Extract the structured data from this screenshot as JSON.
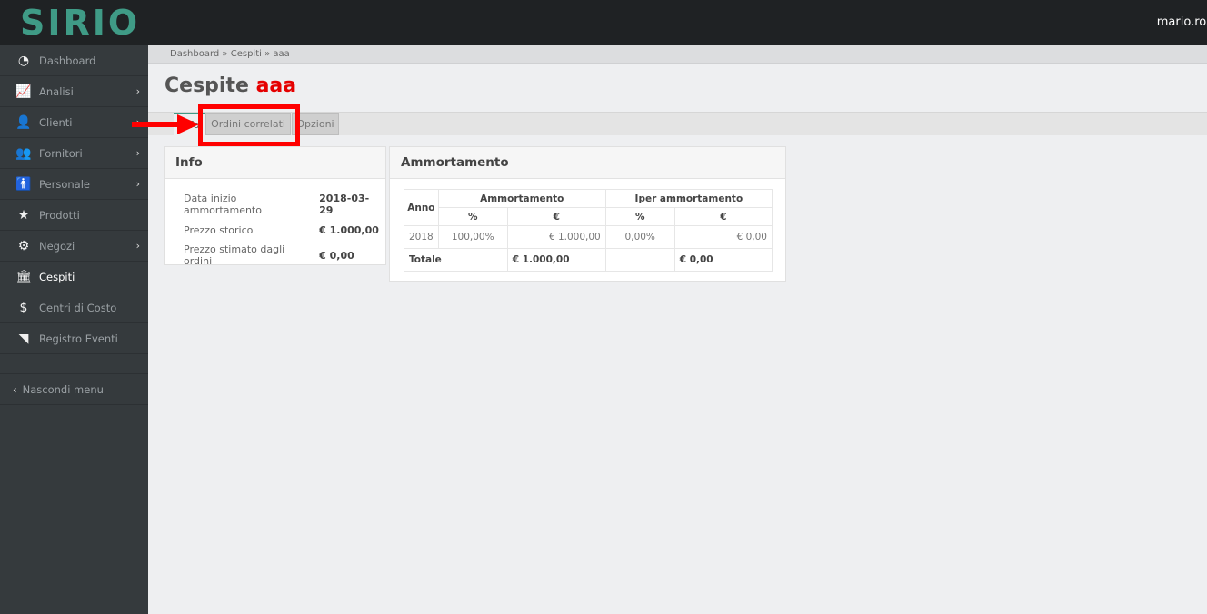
{
  "app": {
    "logo": "SIRIO",
    "user": "mario.ros"
  },
  "sidebar": {
    "items": [
      {
        "label": "Dashboard",
        "icon": "dashboard-icon",
        "glyph": "◔",
        "chevron": false,
        "active": false
      },
      {
        "label": "Analisi",
        "icon": "line-chart-icon",
        "glyph": "📈",
        "chevron": true,
        "active": false
      },
      {
        "label": "Clienti",
        "icon": "user-icon",
        "glyph": "👤",
        "chevron": true,
        "active": false
      },
      {
        "label": "Fornitori",
        "icon": "users-icon",
        "glyph": "👥",
        "chevron": true,
        "active": false
      },
      {
        "label": "Personale",
        "icon": "male-icon",
        "glyph": "🚹",
        "chevron": true,
        "active": false
      },
      {
        "label": "Prodotti",
        "icon": "star-icon",
        "glyph": "★",
        "chevron": false,
        "active": false
      },
      {
        "label": "Negozi",
        "icon": "gear-icon",
        "glyph": "⚙",
        "chevron": true,
        "active": false
      },
      {
        "label": "Cespiti",
        "icon": "bank-icon",
        "glyph": "🏛",
        "chevron": false,
        "active": true
      },
      {
        "label": "Centri di Costo",
        "icon": "dollar-icon",
        "glyph": "$",
        "chevron": false,
        "active": false
      },
      {
        "label": "Registro Eventi",
        "icon": "rss-icon",
        "glyph": "◥",
        "chevron": false,
        "active": false
      }
    ],
    "hide_menu": "Nascondi menu",
    "chevron_glyph": "›",
    "hide_glyph": "‹"
  },
  "breadcrumb": "Dashboard » Cespiti » aaa",
  "page": {
    "title": "Cespite",
    "title_accent": "aaa"
  },
  "tabs": [
    {
      "label": "Info",
      "active": true
    },
    {
      "label": "Ordini correlati",
      "active": false
    },
    {
      "label": "Opzioni",
      "active": false
    }
  ],
  "info_panel": {
    "title": "Info",
    "rows": [
      {
        "label": "Data inizio ammortamento",
        "value": "2018-03-29"
      },
      {
        "label": "Prezzo storico",
        "value": "€ 1.000,00"
      },
      {
        "label": "Prezzo stimato dagli ordini",
        "value": "€ 0,00"
      }
    ]
  },
  "amm_panel": {
    "title": "Ammortamento",
    "headers": {
      "anno": "Anno",
      "ammortamento": "Ammortamento",
      "iper": "Iper ammortamento",
      "pct": "%",
      "eur": "€"
    },
    "rows": [
      {
        "anno": "2018",
        "amm_pct": "100,00%",
        "amm_eur": "€ 1.000,00",
        "iper_pct": "0,00%",
        "iper_eur": "€ 0,00"
      }
    ],
    "total": {
      "label": "Totale",
      "amm_eur": "€ 1.000,00",
      "iper_eur": "€ 0,00"
    }
  },
  "colors": {
    "brand": "#3f9b86",
    "accent": "#e50000",
    "annotation": "#ff0000"
  }
}
